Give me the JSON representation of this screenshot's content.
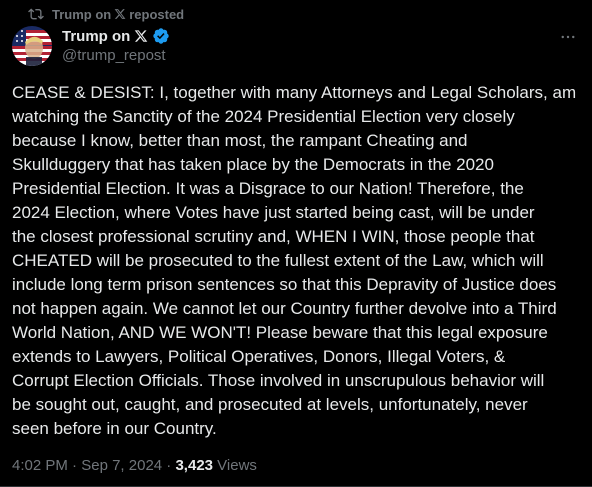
{
  "colors": {
    "background": "#000000",
    "text_primary": "#e7e9ea",
    "text_secondary": "#71767b",
    "verified_badge": "#1d9bf0"
  },
  "repost_header": {
    "icon": "repost-icon",
    "account_name": "Trump on",
    "x_logo": "x-logo-icon",
    "action": "reposted"
  },
  "author": {
    "display_name": "Trump on",
    "x_logo": "x-logo-icon",
    "verified_icon": "verified-badge-icon",
    "handle": "@trump_repost",
    "avatar": "flag-portrait-avatar"
  },
  "more_menu": {
    "icon": "more-horizontal-icon"
  },
  "tweet": {
    "lines": [
      "CEASE & DESIST: I, together with many Attorneys and Legal Scholars, am",
      "watching the Sanctity of the 2024 Presidential Election very closely",
      "because I know, better than most, the rampant Cheating and",
      "Skullduggery that has taken place by the Democrats in the 2020",
      "Presidential Election. It was a Disgrace to our Nation! Therefore, the",
      "2024 Election, where Votes have just started being cast, will be under",
      "the closest professional scrutiny and, WHEN I WIN, those people that",
      "CHEATED will be prosecuted to the fullest extent of the Law, which will",
      "include long term prison sentences so that this Depravity of Justice does",
      "not happen again. We cannot let our Country further devolve into a Third",
      "World Nation, AND WE WON'T! Please beware that this legal exposure",
      "extends to Lawyers, Political Operatives, Donors, Illegal Voters, &",
      "Corrupt Election Officials. Those involved in unscrupulous behavior will",
      "be sought out, caught, and prosecuted at levels, unfortunately, never",
      "seen before in our Country."
    ]
  },
  "meta": {
    "time": "4:02 PM",
    "separator": " · ",
    "date": "Sep 7, 2024",
    "views_count": "3,423",
    "views_label": " Views"
  }
}
